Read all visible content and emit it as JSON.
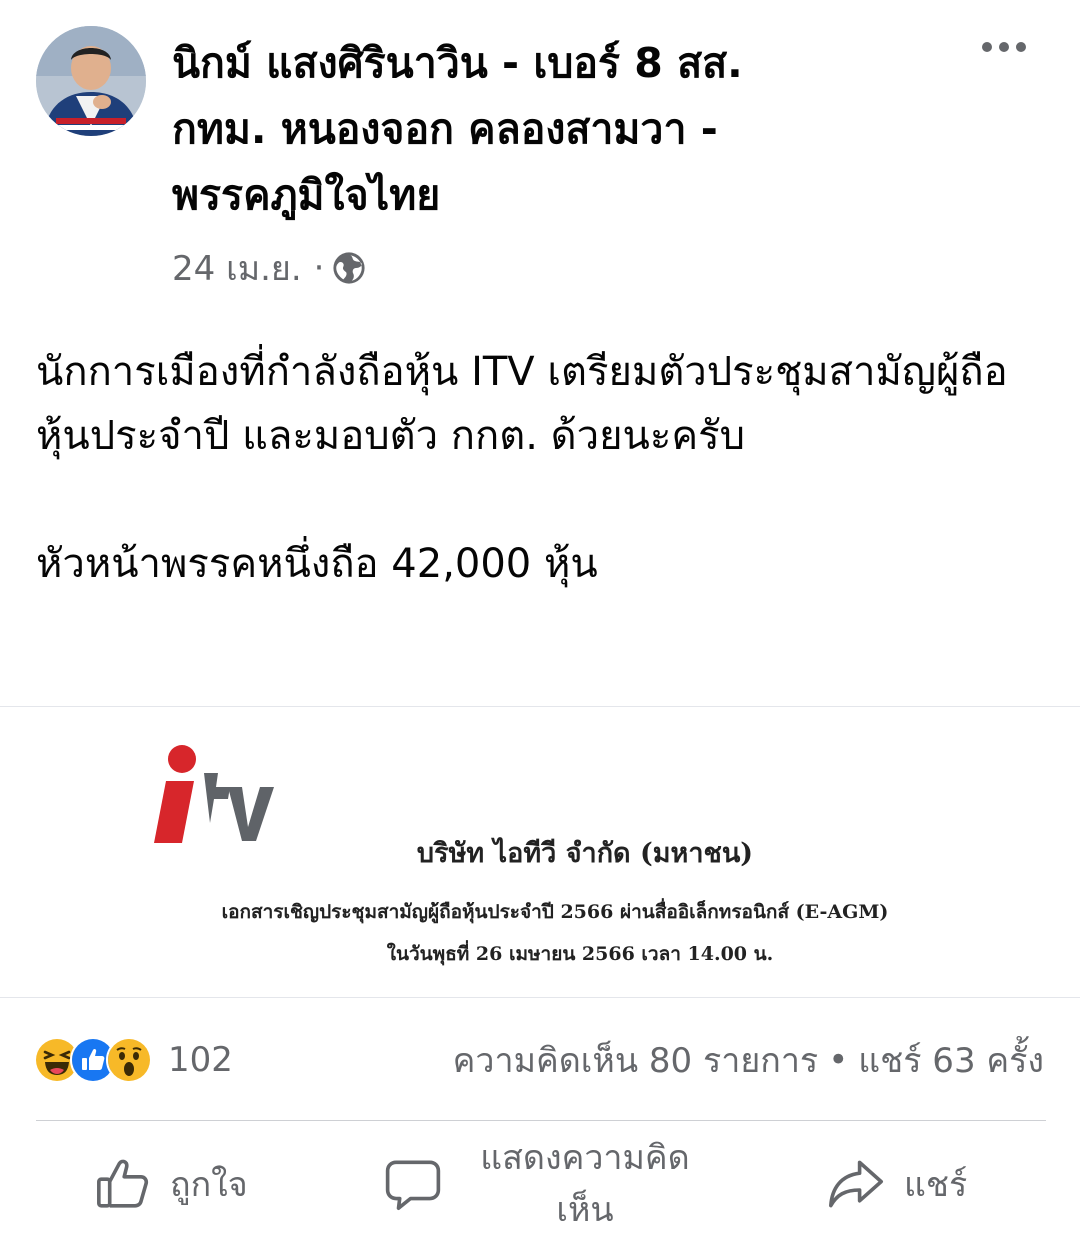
{
  "post": {
    "author": "นิกม์ แสงศิรินาวิน - เบอร์ 8 สส.\nกทม. หนองจอก คลองสามวา -\nพรรคภูมิใจไทย",
    "date": "24 เม.ย.",
    "separator": "·",
    "privacy_icon": "globe-icon",
    "more_icon": "more-options-icon",
    "paragraphs": [
      "นักการเมืองที่กำลังถือหุ้น ITV เตรียมตัวประชุมสามัญผู้ถือหุ้นประจำปี และมอบตัว กกต. ด้วยนะครับ",
      "หัวหน้าพรรคหนึ่งถือ 42,000 หุ้น"
    ]
  },
  "attachment": {
    "logo_text": "itv",
    "company": "บริษัท ไอทีวี จำกัด (มหาชน)",
    "line1": "เอกสารเชิญประชุมสามัญผู้ถือหุ้นประจำปี 2566 ผ่านสื่ออิเล็กทรอนิกส์ (E-AGM)",
    "line2": "ในวันพุธที่ 26 เมษายน 2566 เวลา 14.00 น.",
    "colors": {
      "logo_red": "#d7262b",
      "logo_grey": "#5f6368"
    }
  },
  "engagement": {
    "reaction_icons": [
      "haha-icon",
      "like-icon",
      "wow-icon"
    ],
    "reaction_count": "102",
    "comments": "ความคิดเห็น 80 รายการ",
    "bullet": "•",
    "shares": "แชร์ 63 ครั้ง"
  },
  "actions": {
    "like_label": "ถูกใจ",
    "comment_label": "แสดงความคิด\nเห็น",
    "share_label": "แชร์"
  },
  "colors": {
    "text_primary": "#050505",
    "text_secondary": "#65676b",
    "like_blue": "#1877f2",
    "reaction_yellow": "#f7b928"
  }
}
